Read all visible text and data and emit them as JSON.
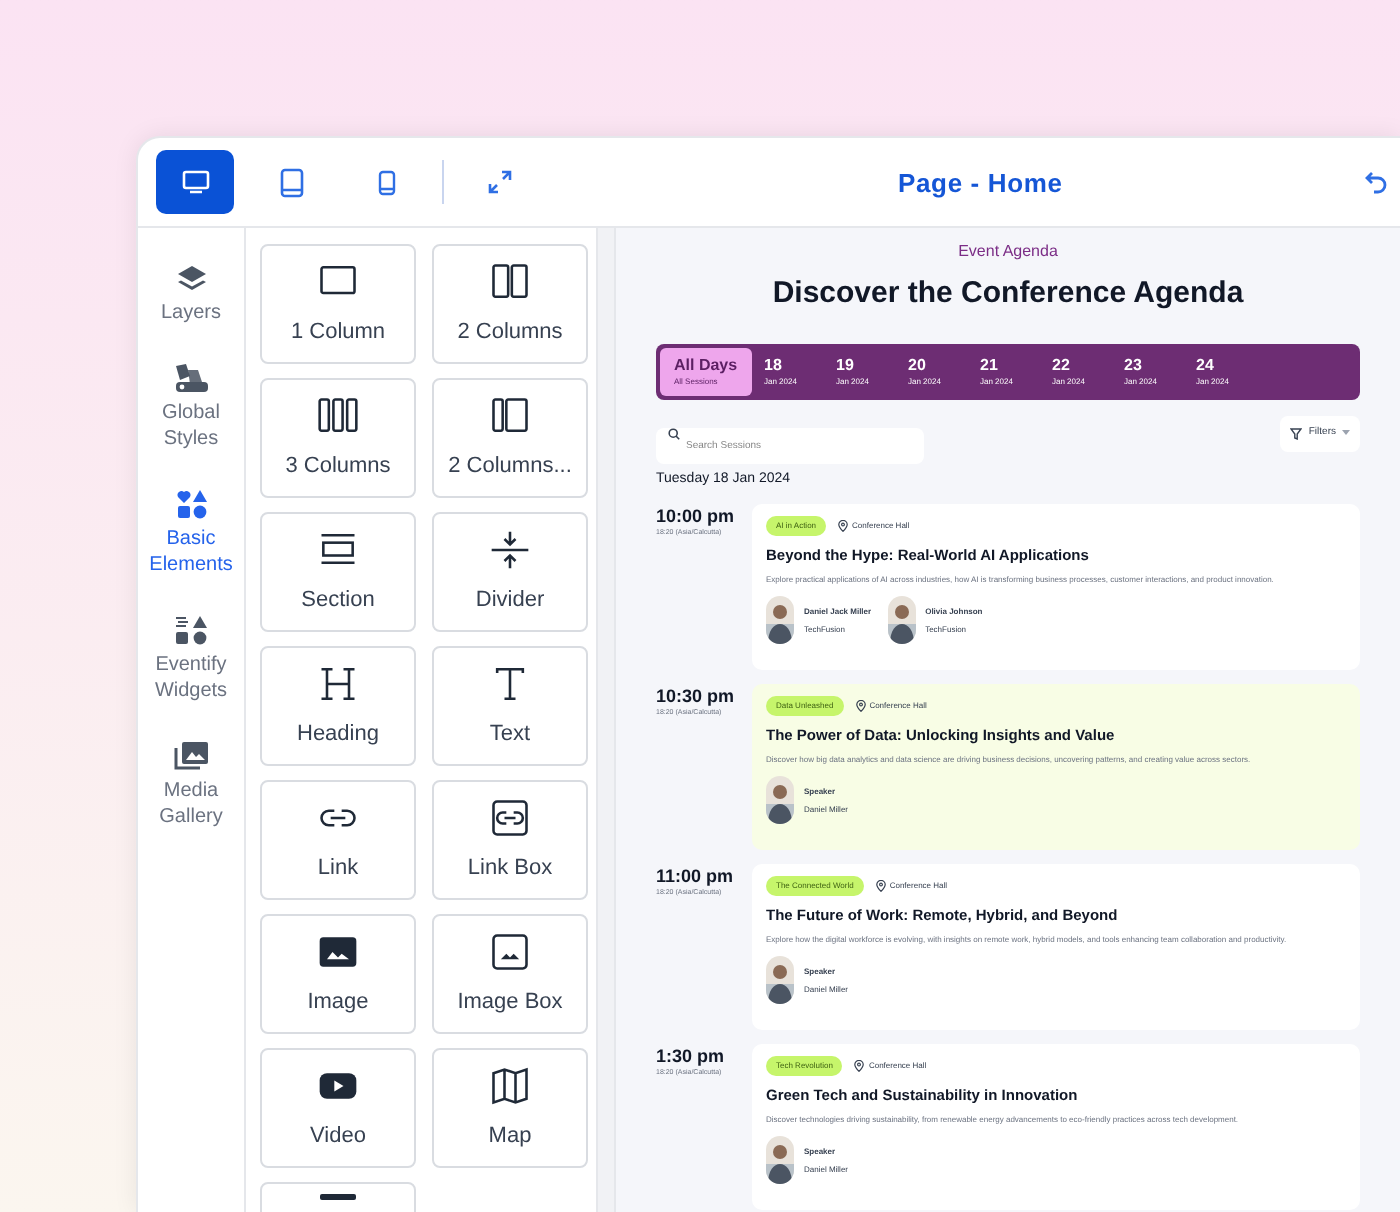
{
  "toolbar": {
    "devices": [
      {
        "selected": true
      },
      {
        "selected": false
      },
      {
        "selected": false
      }
    ],
    "title": "Page - Home"
  },
  "sidebar": {
    "items": [
      {
        "label": "Layers",
        "selected": false
      },
      {
        "label": "Global Styles",
        "selected": false
      },
      {
        "label": "Basic Elements",
        "selected": true
      },
      {
        "label": "Eventify Widgets",
        "selected": false
      },
      {
        "label": "Media Gallery",
        "selected": false
      }
    ]
  },
  "elements": [
    {
      "label": "1 Column"
    },
    {
      "label": "2 Columns"
    },
    {
      "label": "3 Columns"
    },
    {
      "label": "2 Columns..."
    },
    {
      "label": "Section"
    },
    {
      "label": "Divider"
    },
    {
      "label": "Heading"
    },
    {
      "label": "Text"
    },
    {
      "label": "Link"
    },
    {
      "label": "Link Box"
    },
    {
      "label": "Image"
    },
    {
      "label": "Image Box"
    },
    {
      "label": "Video"
    },
    {
      "label": "Map"
    },
    {
      "kind": "partial"
    }
  ],
  "preview": {
    "eyebrow": "Event Agenda",
    "title": "Discover the Conference Agenda",
    "days": [
      {
        "day": "All Days",
        "sub": "All Sessions",
        "selected": true
      },
      {
        "day": "18",
        "sub": "Jan 2024",
        "selected": false
      },
      {
        "day": "19",
        "sub": "Jan 2024",
        "selected": false
      },
      {
        "day": "20",
        "sub": "Jan 2024",
        "selected": false
      },
      {
        "day": "21",
        "sub": "Jan 2024",
        "selected": false
      },
      {
        "day": "22",
        "sub": "Jan 2024",
        "selected": false
      },
      {
        "day": "23",
        "sub": "Jan 2024",
        "selected": false
      },
      {
        "day": "24",
        "sub": "Jan 2024",
        "selected": false
      }
    ],
    "search": {
      "placeholder": "Search Sessions"
    },
    "filters": "Filters",
    "date_heading": "Tuesday 18 Jan 2024",
    "sessions": [
      {
        "time": "10:00 pm",
        "zone": "18:20 (Asia/Calcutta)",
        "tag": "AI in Action",
        "location": "Conference Hall",
        "title": "Beyond the Hype: Real-World AI Applications",
        "description": "Explore practical applications of AI across industries, how AI is transforming business processes, customer interactions, and product innovation.",
        "highlighted": false,
        "speakers": [
          {
            "name": "Daniel Jack Miller",
            "detail": "TechFusion"
          },
          {
            "name": "Olivia Johnson",
            "detail": "TechFusion"
          }
        ]
      },
      {
        "time": "10:30 pm",
        "zone": "18:20 (Asia/Calcutta)",
        "tag": "Data Unleashed",
        "location": "Conference Hall",
        "title": "The Power of Data: Unlocking Insights and Value",
        "description": "Discover how big data analytics and data science are driving business decisions, uncovering patterns, and creating value across sectors.",
        "highlighted": true,
        "speakers": [
          {
            "name": "Speaker",
            "detail": "Daniel Miller"
          }
        ]
      },
      {
        "time": "11:00 pm",
        "zone": "18:20 (Asia/Calcutta)",
        "tag": "The Connected World",
        "location": "Conference Hall",
        "title": "The Future of Work: Remote, Hybrid, and Beyond",
        "description": "Explore how the digital workforce is evolving, with insights on remote work, hybrid models, and tools enhancing team collaboration and productivity.",
        "highlighted": false,
        "speakers": [
          {
            "name": "Speaker",
            "detail": "Daniel Miller"
          }
        ]
      },
      {
        "time": "1:30 pm",
        "zone": "18:20 (Asia/Calcutta)",
        "tag": "Tech Revolution",
        "location": "Conference Hall",
        "title": "Green Tech and Sustainability in Innovation",
        "description": "Discover technologies driving sustainability, from renewable energy advancements to eco-friendly practices across tech development.",
        "highlighted": false,
        "speakers": [
          {
            "name": "Speaker",
            "detail": "Daniel Miller"
          }
        ]
      }
    ]
  }
}
